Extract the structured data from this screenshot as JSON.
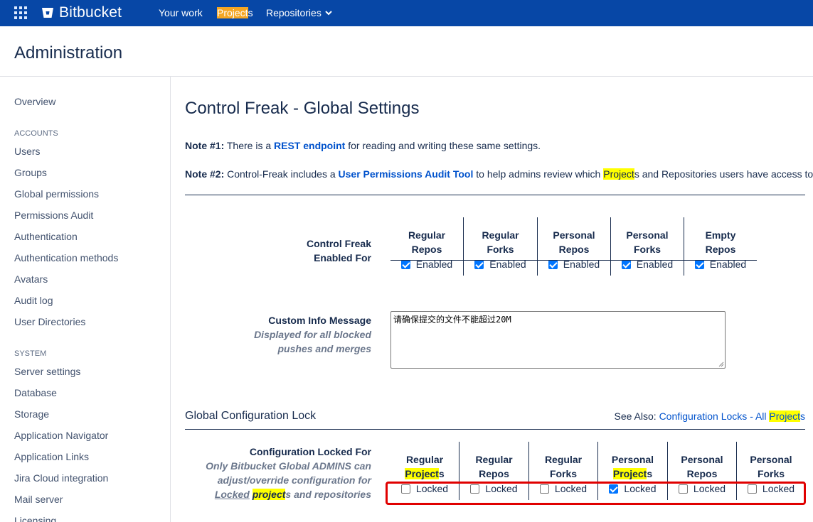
{
  "nav": {
    "brand": "Bitbucket",
    "your_work": "Your work",
    "projects_highlight": "Project",
    "projects_rest": "s",
    "repositories": "Repositories"
  },
  "header": {
    "title": "Administration"
  },
  "sidebar": {
    "overview": "Overview",
    "accounts_heading": "ACCOUNTS",
    "accounts": [
      "Users",
      "Groups",
      "Global permissions",
      "Permissions Audit",
      "Authentication",
      "Authentication methods",
      "Avatars",
      "Audit log",
      "User Directories"
    ],
    "system_heading": "SYSTEM",
    "system": [
      "Server settings",
      "Database",
      "Storage",
      "Application Navigator",
      "Application Links",
      "Jira Cloud integration",
      "Mail server",
      "Licensing"
    ]
  },
  "main": {
    "title": "Control Freak - Global Settings",
    "note1": {
      "label": "Note #1:",
      "text_a": " There is a ",
      "link": "REST endpoint",
      "text_b": " for reading and writing these same settings."
    },
    "note2": {
      "label": "Note #2:",
      "text_a": " Control-Freak includes a ",
      "link": "User Permissions Audit Tool",
      "text_b": " to help admins review which ",
      "hl": "Project",
      "text_c": "s and Repositories users have access to."
    },
    "enabled_for": {
      "label_line1": "Control Freak",
      "label_line2": "Enabled For",
      "columns": [
        {
          "line1": "Regular",
          "line2": "Repos",
          "check_label": "Enabled",
          "checked": true
        },
        {
          "line1": "Regular",
          "line2": "Forks",
          "check_label": "Enabled",
          "checked": true
        },
        {
          "line1": "Personal",
          "line2": "Repos",
          "check_label": "Enabled",
          "checked": true
        },
        {
          "line1": "Personal",
          "line2": "Forks",
          "check_label": "Enabled",
          "checked": true
        },
        {
          "line1": "Empty",
          "line2": "Repos",
          "check_label": "Enabled",
          "checked": true
        }
      ]
    },
    "custom_info": {
      "label": "Custom Info Message",
      "sub1": "Displayed for all blocked",
      "sub2": "pushes and merges",
      "value": "请确保提交的文件不能超过20M"
    },
    "lock_section": {
      "title": "Global Configuration Lock",
      "see_also_label": "See Also: ",
      "see_also_link": "Configuration Locks - All ",
      "see_also_hl": "Project",
      "see_also_s": "s"
    },
    "locked_for": {
      "label": "Configuration Locked For",
      "sub1": "Only Bitbucket Global ADMINS can",
      "sub2": "adjust/override configuration for",
      "sub3_a": "Locked",
      "sub3_hl": "project",
      "sub3_b": "s and repositories",
      "columns": [
        {
          "line1": "Regular",
          "line2_hl": "Project",
          "line2_rest": "s",
          "check_label": "Locked",
          "checked": false
        },
        {
          "line1": "Regular",
          "line2_hl": "",
          "line2_rest": "Repos",
          "check_label": "Locked",
          "checked": false
        },
        {
          "line1": "Regular",
          "line2_hl": "",
          "line2_rest": "Forks",
          "check_label": "Locked",
          "checked": false
        },
        {
          "line1": "Personal",
          "line2_hl": "Project",
          "line2_rest": "s",
          "check_label": "Locked",
          "checked": true
        },
        {
          "line1": "Personal",
          "line2_hl": "",
          "line2_rest": "Repos",
          "check_label": "Locked",
          "checked": false
        },
        {
          "line1": "Personal",
          "line2_hl": "",
          "line2_rest": "Forks",
          "check_label": "Locked",
          "checked": false
        }
      ]
    }
  }
}
